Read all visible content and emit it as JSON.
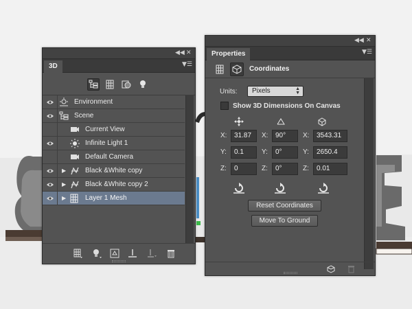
{
  "panel_3d": {
    "tab_label": "3D",
    "filters": [
      {
        "icon": "scene-filter-icon",
        "active": true
      },
      {
        "icon": "mesh-filter-icon",
        "active": false
      },
      {
        "icon": "material-filter-icon",
        "active": false
      },
      {
        "icon": "light-filter-icon",
        "active": false
      }
    ],
    "layers": [
      {
        "label": "Environment",
        "icon": "environment-icon",
        "eye": true,
        "expandable": false,
        "indent": 0,
        "selected": false
      },
      {
        "label": "Scene",
        "icon": "scene-icon",
        "eye": true,
        "expandable": false,
        "indent": 0,
        "selected": false
      },
      {
        "label": "Current View",
        "icon": "camera-icon",
        "eye": false,
        "expandable": false,
        "indent": 1,
        "selected": false
      },
      {
        "label": "Infinite Light 1",
        "icon": "light-icon",
        "eye": true,
        "expandable": false,
        "indent": 1,
        "selected": false
      },
      {
        "label": "Default Camera",
        "icon": "camera-icon",
        "eye": false,
        "expandable": false,
        "indent": 1,
        "selected": false
      },
      {
        "label": "Black &White copy",
        "icon": "mesh-icon",
        "eye": true,
        "expandable": true,
        "indent": 1,
        "selected": false
      },
      {
        "label": "Black &White copy 2",
        "icon": "mesh-icon",
        "eye": true,
        "expandable": true,
        "indent": 1,
        "selected": false
      },
      {
        "label": "Layer 1 Mesh",
        "icon": "mesh-layer-icon",
        "eye": true,
        "expandable": true,
        "indent": 1,
        "selected": true
      }
    ],
    "bottom_actions": [
      "add-mesh-icon",
      "add-light-icon",
      "render-icon",
      "drop-to-ground-icon",
      "new-constraint-icon",
      "delete-icon"
    ]
  },
  "properties": {
    "tab_label": "Properties",
    "section_title": "Coordinates",
    "units_label": "Units:",
    "units_value": "Pixels",
    "show_dimensions_label": "Show 3D Dimensions On Canvas",
    "show_dimensions_checked": false,
    "columns": [
      {
        "icon": "move-icon",
        "x_label": "X:",
        "y_label": "Y:",
        "z_label": "Z:",
        "x": "31.87",
        "y": "0.1",
        "z": "0"
      },
      {
        "icon": "rotate-icon",
        "x_label": "X:",
        "y_label": "Y:",
        "z_label": "Z:",
        "x": "90°",
        "y": "0°",
        "z": "0°"
      },
      {
        "icon": "scale-icon",
        "x_label": "X:",
        "y_label": "Y:",
        "z_label": "Z:",
        "x": "3543.31",
        "y": "2650.4",
        "z": "0.01"
      }
    ],
    "reset_button": "Reset Coordinates",
    "ground_button": "Move To Ground"
  },
  "colors": {
    "panel_bg": "#535353",
    "selected_row": "#6b7a8f",
    "field_bg": "#3b3b3b"
  }
}
